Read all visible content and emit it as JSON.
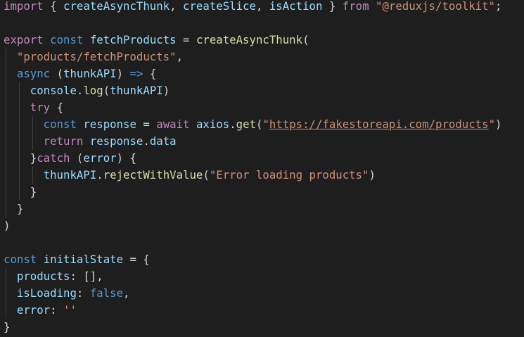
{
  "editor": {
    "language": "javascript",
    "theme": "dark",
    "lines": [
      {
        "indent": 0,
        "tokens": [
          {
            "t": "import",
            "c": "kwc"
          },
          {
            "t": " ",
            "c": "pl"
          },
          {
            "t": "{",
            "c": "b1"
          },
          {
            "t": " ",
            "c": "pl"
          },
          {
            "t": "createAsyncThunk",
            "c": "var"
          },
          {
            "t": ", ",
            "c": "pl"
          },
          {
            "t": "createSlice",
            "c": "var"
          },
          {
            "t": ", ",
            "c": "pl"
          },
          {
            "t": "isAction",
            "c": "var"
          },
          {
            "t": " ",
            "c": "pl"
          },
          {
            "t": "}",
            "c": "b1"
          },
          {
            "t": " ",
            "c": "pl"
          },
          {
            "t": "from",
            "c": "kwc"
          },
          {
            "t": " ",
            "c": "pl"
          },
          {
            "t": "\"@reduxjs/toolkit\"",
            "c": "str"
          },
          {
            "t": ";",
            "c": "pl"
          }
        ]
      },
      {
        "indent": 0,
        "tokens": []
      },
      {
        "indent": 0,
        "tokens": [
          {
            "t": "export",
            "c": "kwc"
          },
          {
            "t": " ",
            "c": "pl"
          },
          {
            "t": "const",
            "c": "kw"
          },
          {
            "t": " ",
            "c": "pl"
          },
          {
            "t": "fetchProducts",
            "c": "var"
          },
          {
            "t": " = ",
            "c": "pl"
          },
          {
            "t": "createAsyncThunk",
            "c": "fn"
          },
          {
            "t": "(",
            "c": "b1"
          }
        ]
      },
      {
        "indent": 1,
        "tokens": [
          {
            "t": "\"products/fetchProducts\"",
            "c": "str"
          },
          {
            "t": ",",
            "c": "pl"
          }
        ]
      },
      {
        "indent": 1,
        "tokens": [
          {
            "t": "async",
            "c": "kw"
          },
          {
            "t": " ",
            "c": "pl"
          },
          {
            "t": "(",
            "c": "b2"
          },
          {
            "t": "thunkAPI",
            "c": "var"
          },
          {
            "t": ")",
            "c": "b2"
          },
          {
            "t": " ",
            "c": "pl"
          },
          {
            "t": "=>",
            "c": "kw"
          },
          {
            "t": " ",
            "c": "pl"
          },
          {
            "t": "{",
            "c": "b2"
          }
        ]
      },
      {
        "indent": 2,
        "tokens": [
          {
            "t": "console",
            "c": "var"
          },
          {
            "t": ".",
            "c": "pl"
          },
          {
            "t": "log",
            "c": "fn"
          },
          {
            "t": "(",
            "c": "b3"
          },
          {
            "t": "thunkAPI",
            "c": "var"
          },
          {
            "t": ")",
            "c": "b3"
          }
        ]
      },
      {
        "indent": 2,
        "tokens": [
          {
            "t": "try",
            "c": "kwc"
          },
          {
            "t": " ",
            "c": "pl"
          },
          {
            "t": "{",
            "c": "b3"
          }
        ]
      },
      {
        "indent": 3,
        "tokens": [
          {
            "t": "const",
            "c": "kw"
          },
          {
            "t": " ",
            "c": "pl"
          },
          {
            "t": "response",
            "c": "var"
          },
          {
            "t": " = ",
            "c": "pl"
          },
          {
            "t": "await",
            "c": "kwc"
          },
          {
            "t": " ",
            "c": "pl"
          },
          {
            "t": "axios",
            "c": "var"
          },
          {
            "t": ".",
            "c": "pl"
          },
          {
            "t": "get",
            "c": "fn"
          },
          {
            "t": "(",
            "c": "b1"
          },
          {
            "t": "\"",
            "c": "str"
          },
          {
            "t": "https://fakestoreapi.com/products",
            "c": "url"
          },
          {
            "t": "\"",
            "c": "str"
          },
          {
            "t": ")",
            "c": "b1"
          }
        ]
      },
      {
        "indent": 3,
        "tokens": [
          {
            "t": "return",
            "c": "kwc"
          },
          {
            "t": " ",
            "c": "pl"
          },
          {
            "t": "response",
            "c": "var"
          },
          {
            "t": ".",
            "c": "pl"
          },
          {
            "t": "data",
            "c": "var"
          }
        ]
      },
      {
        "indent": 2,
        "tokens": [
          {
            "t": "}",
            "c": "b3"
          },
          {
            "t": "catch",
            "c": "kwc"
          },
          {
            "t": " ",
            "c": "pl"
          },
          {
            "t": "(",
            "c": "b3"
          },
          {
            "t": "error",
            "c": "var"
          },
          {
            "t": ")",
            "c": "b3"
          },
          {
            "t": " ",
            "c": "pl"
          },
          {
            "t": "{",
            "c": "b3"
          }
        ]
      },
      {
        "indent": 3,
        "tokens": [
          {
            "t": "thunkAPI",
            "c": "var"
          },
          {
            "t": ".",
            "c": "pl"
          },
          {
            "t": "rejectWithValue",
            "c": "fn"
          },
          {
            "t": "(",
            "c": "b1"
          },
          {
            "t": "\"Error loading products\"",
            "c": "str"
          },
          {
            "t": ")",
            "c": "b1"
          }
        ]
      },
      {
        "indent": 2,
        "tokens": [
          {
            "t": "}",
            "c": "b3"
          }
        ]
      },
      {
        "indent": 1,
        "tokens": [
          {
            "t": "}",
            "c": "b2"
          }
        ]
      },
      {
        "indent": 0,
        "tokens": [
          {
            "t": ")",
            "c": "b1"
          }
        ]
      },
      {
        "indent": 0,
        "tokens": []
      },
      {
        "indent": 0,
        "tokens": [
          {
            "t": "const",
            "c": "kw"
          },
          {
            "t": " ",
            "c": "pl"
          },
          {
            "t": "initialState",
            "c": "var"
          },
          {
            "t": " = ",
            "c": "pl"
          },
          {
            "t": "{",
            "c": "b1"
          }
        ]
      },
      {
        "indent": 1,
        "tokens": [
          {
            "t": "products",
            "c": "var"
          },
          {
            "t": ": ",
            "c": "pl"
          },
          {
            "t": "[]",
            "c": "b2"
          },
          {
            "t": ",",
            "c": "pl"
          }
        ]
      },
      {
        "indent": 1,
        "tokens": [
          {
            "t": "isLoading",
            "c": "var"
          },
          {
            "t": ": ",
            "c": "pl"
          },
          {
            "t": "false",
            "c": "kw"
          },
          {
            "t": ",",
            "c": "pl"
          }
        ]
      },
      {
        "indent": 1,
        "tokens": [
          {
            "t": "error",
            "c": "var"
          },
          {
            "t": ": ",
            "c": "pl"
          },
          {
            "t": "''",
            "c": "str"
          }
        ]
      },
      {
        "indent": 0,
        "tokens": [
          {
            "t": "}",
            "c": "b1"
          }
        ]
      }
    ],
    "indent_guides": [
      {
        "level": 1,
        "from_line": 3,
        "to_line": 12
      },
      {
        "level": 2,
        "from_line": 5,
        "to_line": 11
      },
      {
        "level": 3,
        "from_line": 7,
        "to_line": 8
      },
      {
        "level": 3,
        "from_line": 10,
        "to_line": 10
      },
      {
        "level": 1,
        "from_line": 16,
        "to_line": 18
      }
    ]
  }
}
